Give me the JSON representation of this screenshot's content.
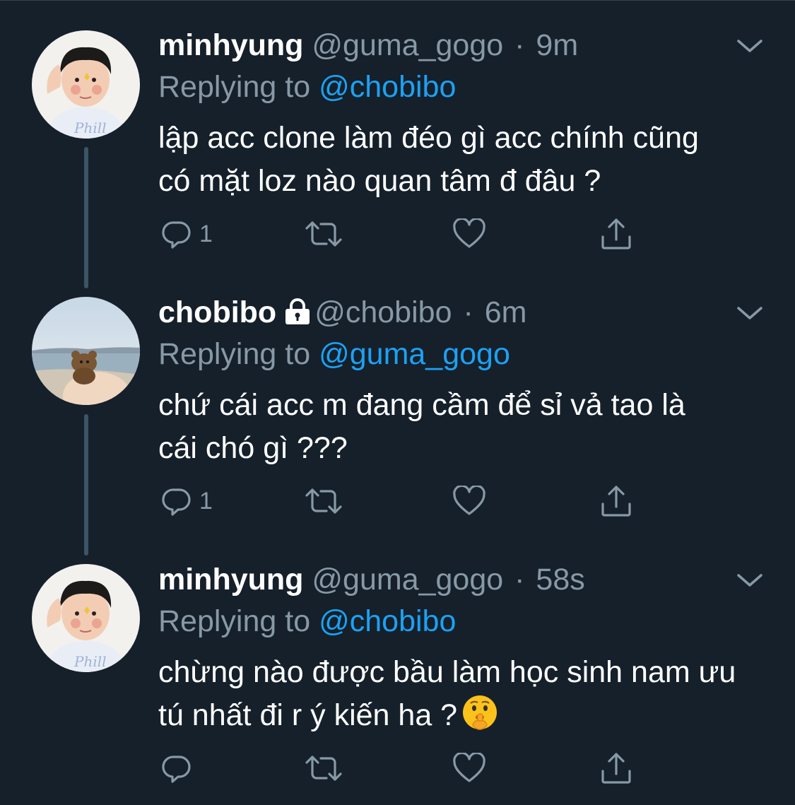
{
  "colors": {
    "background": "#15202b",
    "text_primary": "#ffffff",
    "text_secondary": "#8899a6",
    "accent": "#1da1f2",
    "thread_line": "#3d5466"
  },
  "tweets": [
    {
      "display_name": "minhyung",
      "handle": "@guma_gogo",
      "separator": "·",
      "time": "9m",
      "reply_prefix": "Replying to",
      "reply_to": "@chobibo",
      "text_lines": [
        "lập acc clone làm đéo gì acc chính cũng",
        "có mặt loz nào quan tâm đ đâu ?"
      ],
      "reply_count": "1",
      "avatar_icon": "child-avatar",
      "locked": false
    },
    {
      "display_name": "chobibo",
      "handle": "@chobibo",
      "separator": "·",
      "time": "6m",
      "reply_prefix": "Replying to",
      "reply_to": "@guma_gogo",
      "text_lines": [
        "chứ cái acc m đang cầm để sỉ vả tao là",
        "cái chó gì ???"
      ],
      "reply_count": "1",
      "avatar_icon": "teddy-bear-beach-avatar",
      "locked": true
    },
    {
      "display_name": "minhyung",
      "handle": "@guma_gogo",
      "separator": "·",
      "time": "58s",
      "reply_prefix": "Replying to",
      "reply_to": "@chobibo",
      "text_lines": [
        "chừng nào được bầu làm học sinh nam ưu",
        "tú nhất đi r ý kiến ha ?"
      ],
      "emoji": "shushing-face",
      "reply_count": "",
      "avatar_icon": "child-avatar",
      "locked": false
    }
  ],
  "icons": {
    "reply": "reply-icon",
    "retweet": "retweet-icon",
    "like": "heart-icon",
    "share": "share-icon",
    "more": "chevron-down-icon",
    "protected": "lock-icon"
  }
}
